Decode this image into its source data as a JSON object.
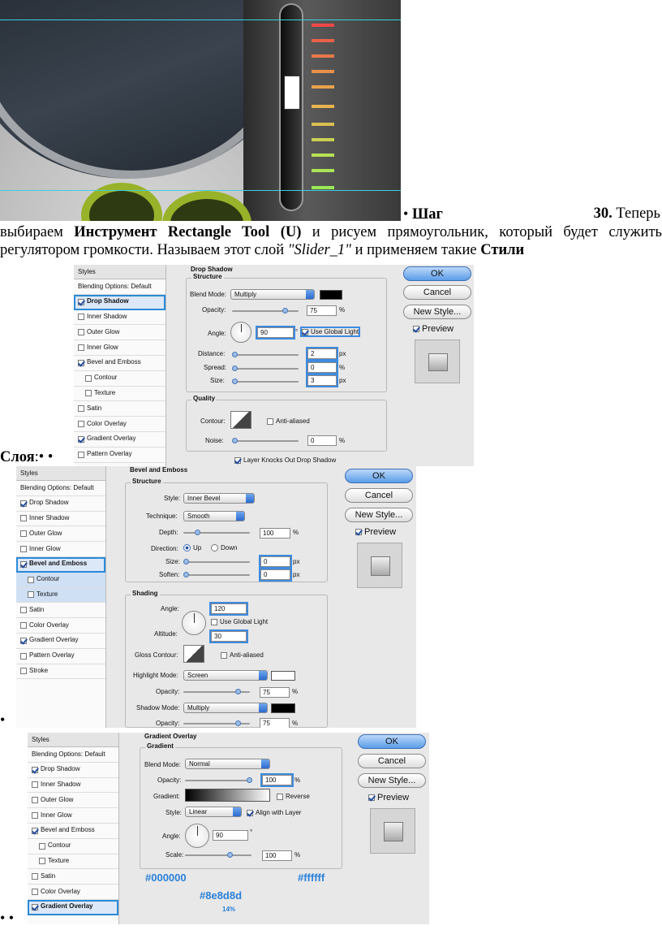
{
  "step": {
    "bullet": "•",
    "label": "Шаг",
    "number": "30.",
    "lead": "Теперь",
    "text_1": "выбираем ",
    "tool": "Инструмент Rectangle Tool (U)",
    "text_2": " и рисуем прямоугольник, который будет служить регулятором громкости. Называем этот слой ",
    "layer_name": "\"Slider_1\"",
    "text_3": " и применяем такие ",
    "styles_bold": "Стили",
    "styles_end": "Слоя",
    "colon": ":",
    "bullets_after": "• •",
    "bullet_single": "•",
    "bullets_end": "• •"
  },
  "colors": {
    "guide": "#3ad0e0",
    "annotation": "#2a80d8",
    "selection": "#2b8ad8"
  },
  "styles_list": [
    "Styles",
    "Blending Options: Default",
    "Drop Shadow",
    "Inner Shadow",
    "Outer Glow",
    "Inner Glow",
    "Bevel and Emboss",
    "Contour",
    "Texture",
    "Satin",
    "Color Overlay",
    "Gradient Overlay",
    "Pattern Overlay",
    "Stroke"
  ],
  "buttons": {
    "ok": "OK",
    "cancel": "Cancel",
    "new_style": "New Style...",
    "preview": "Preview"
  },
  "panel1": {
    "title": "Drop Shadow",
    "structure": "Structure",
    "blend_mode_label": "Blend Mode:",
    "blend_mode": "Multiply",
    "opacity_label": "Opacity:",
    "opacity": "75",
    "angle_label": "Angle:",
    "angle": "90",
    "global_light": "Use Global Light",
    "distance_label": "Distance:",
    "distance": "2",
    "spread_label": "Spread:",
    "spread": "0",
    "size_label": "Size:",
    "size": "3",
    "quality": "Quality",
    "contour_label": "Contour:",
    "anti_aliased": "Anti-aliased",
    "noise_label": "Noise:",
    "noise": "0",
    "knocks_out": "Layer Knocks Out Drop Shadow",
    "pct": "%",
    "px": "px",
    "deg": "°"
  },
  "panel2": {
    "title": "Bevel and Emboss",
    "structure": "Structure",
    "style_label": "Style:",
    "style": "Inner Bevel",
    "technique_label": "Technique:",
    "technique": "Smooth",
    "depth_label": "Depth:",
    "depth": "100",
    "direction_label": "Direction:",
    "up": "Up",
    "down": "Down",
    "size_label": "Size:",
    "size": "0",
    "soften_label": "Soften:",
    "soften": "0",
    "shading": "Shading",
    "angle_label": "Angle:",
    "angle": "120",
    "global_light": "Use Global Light",
    "altitude_label": "Altitude:",
    "altitude": "30",
    "gloss_label": "Gloss Contour:",
    "anti_aliased": "Anti-aliased",
    "highlight_label": "Highlight Mode:",
    "highlight": "Screen",
    "opacity_label": "Opacity:",
    "opacity_h": "75",
    "shadow_label": "Shadow Mode:",
    "shadow": "Multiply",
    "opacity_s": "75",
    "pct": "%",
    "px": "px"
  },
  "panel3": {
    "title": "Gradient Overlay",
    "gradient": "Gradient",
    "blend_mode_label": "Blend Mode:",
    "blend_mode": "Normal",
    "opacity_label": "Opacity:",
    "opacity": "100",
    "gradient_label": "Gradient:",
    "reverse": "Reverse",
    "style_label": "Style:",
    "style": "Linear",
    "align": "Align with Layer",
    "angle_label": "Angle:",
    "angle": "90",
    "scale_label": "Scale:",
    "scale": "100",
    "color_left": "#000000",
    "color_right": "#ffffff",
    "color_mid": "#8e8d8d",
    "mid_pct": "14%",
    "pct": "%",
    "deg": "°"
  }
}
